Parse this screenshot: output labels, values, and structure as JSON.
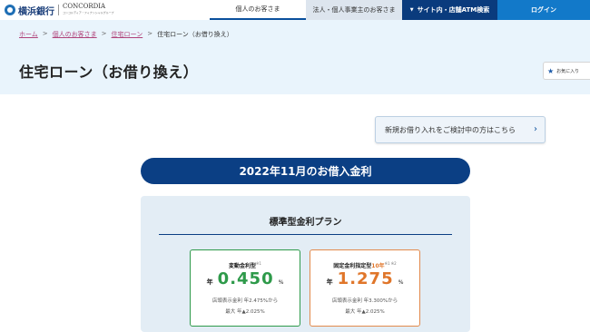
{
  "header": {
    "logo_text": "横浜銀行",
    "logo_partner": "CONCORDIA",
    "logo_partner_sub": "コンコルディア・フィナンシャルグループ",
    "nav": {
      "personal": "個人のお客さま",
      "corporate": "法人・個人事業主のお客さま",
      "atm": "サイト内・店舗ATM検索",
      "login": "ログイン"
    }
  },
  "breadcrumb": {
    "home": "ホーム",
    "personal": "個人のお客さま",
    "housing": "住宅ローン",
    "current": "住宅ローン（お借り換え）",
    "separator": ">"
  },
  "page_title": "住宅ローン（お借り換え）",
  "favorite_label": "お気に入り",
  "new_loan_button": "新規お借り入れをご検討中の方はこちら",
  "rate_banner": "2022年11月のお借入金利",
  "plan": {
    "title": "標準型金利プラン",
    "variable": {
      "label": "変動金利型",
      "note": "※1",
      "prefix": "年",
      "rate": "0.450",
      "unit": "%",
      "store_rate": "店頭表示金利 年2.475%から",
      "max_discount": "最大 年▲2.025%",
      "color": "#2e9a4a"
    },
    "fixed": {
      "label_pre": "固定金利指定型",
      "label_years": "10年",
      "note": "※1 ※2",
      "prefix": "年",
      "rate": "1.275",
      "unit": "%",
      "store_rate": "店頭表示金利 年3.300%から",
      "max_discount": "最大 年▲2.025%",
      "color": "#e0762a"
    }
  }
}
